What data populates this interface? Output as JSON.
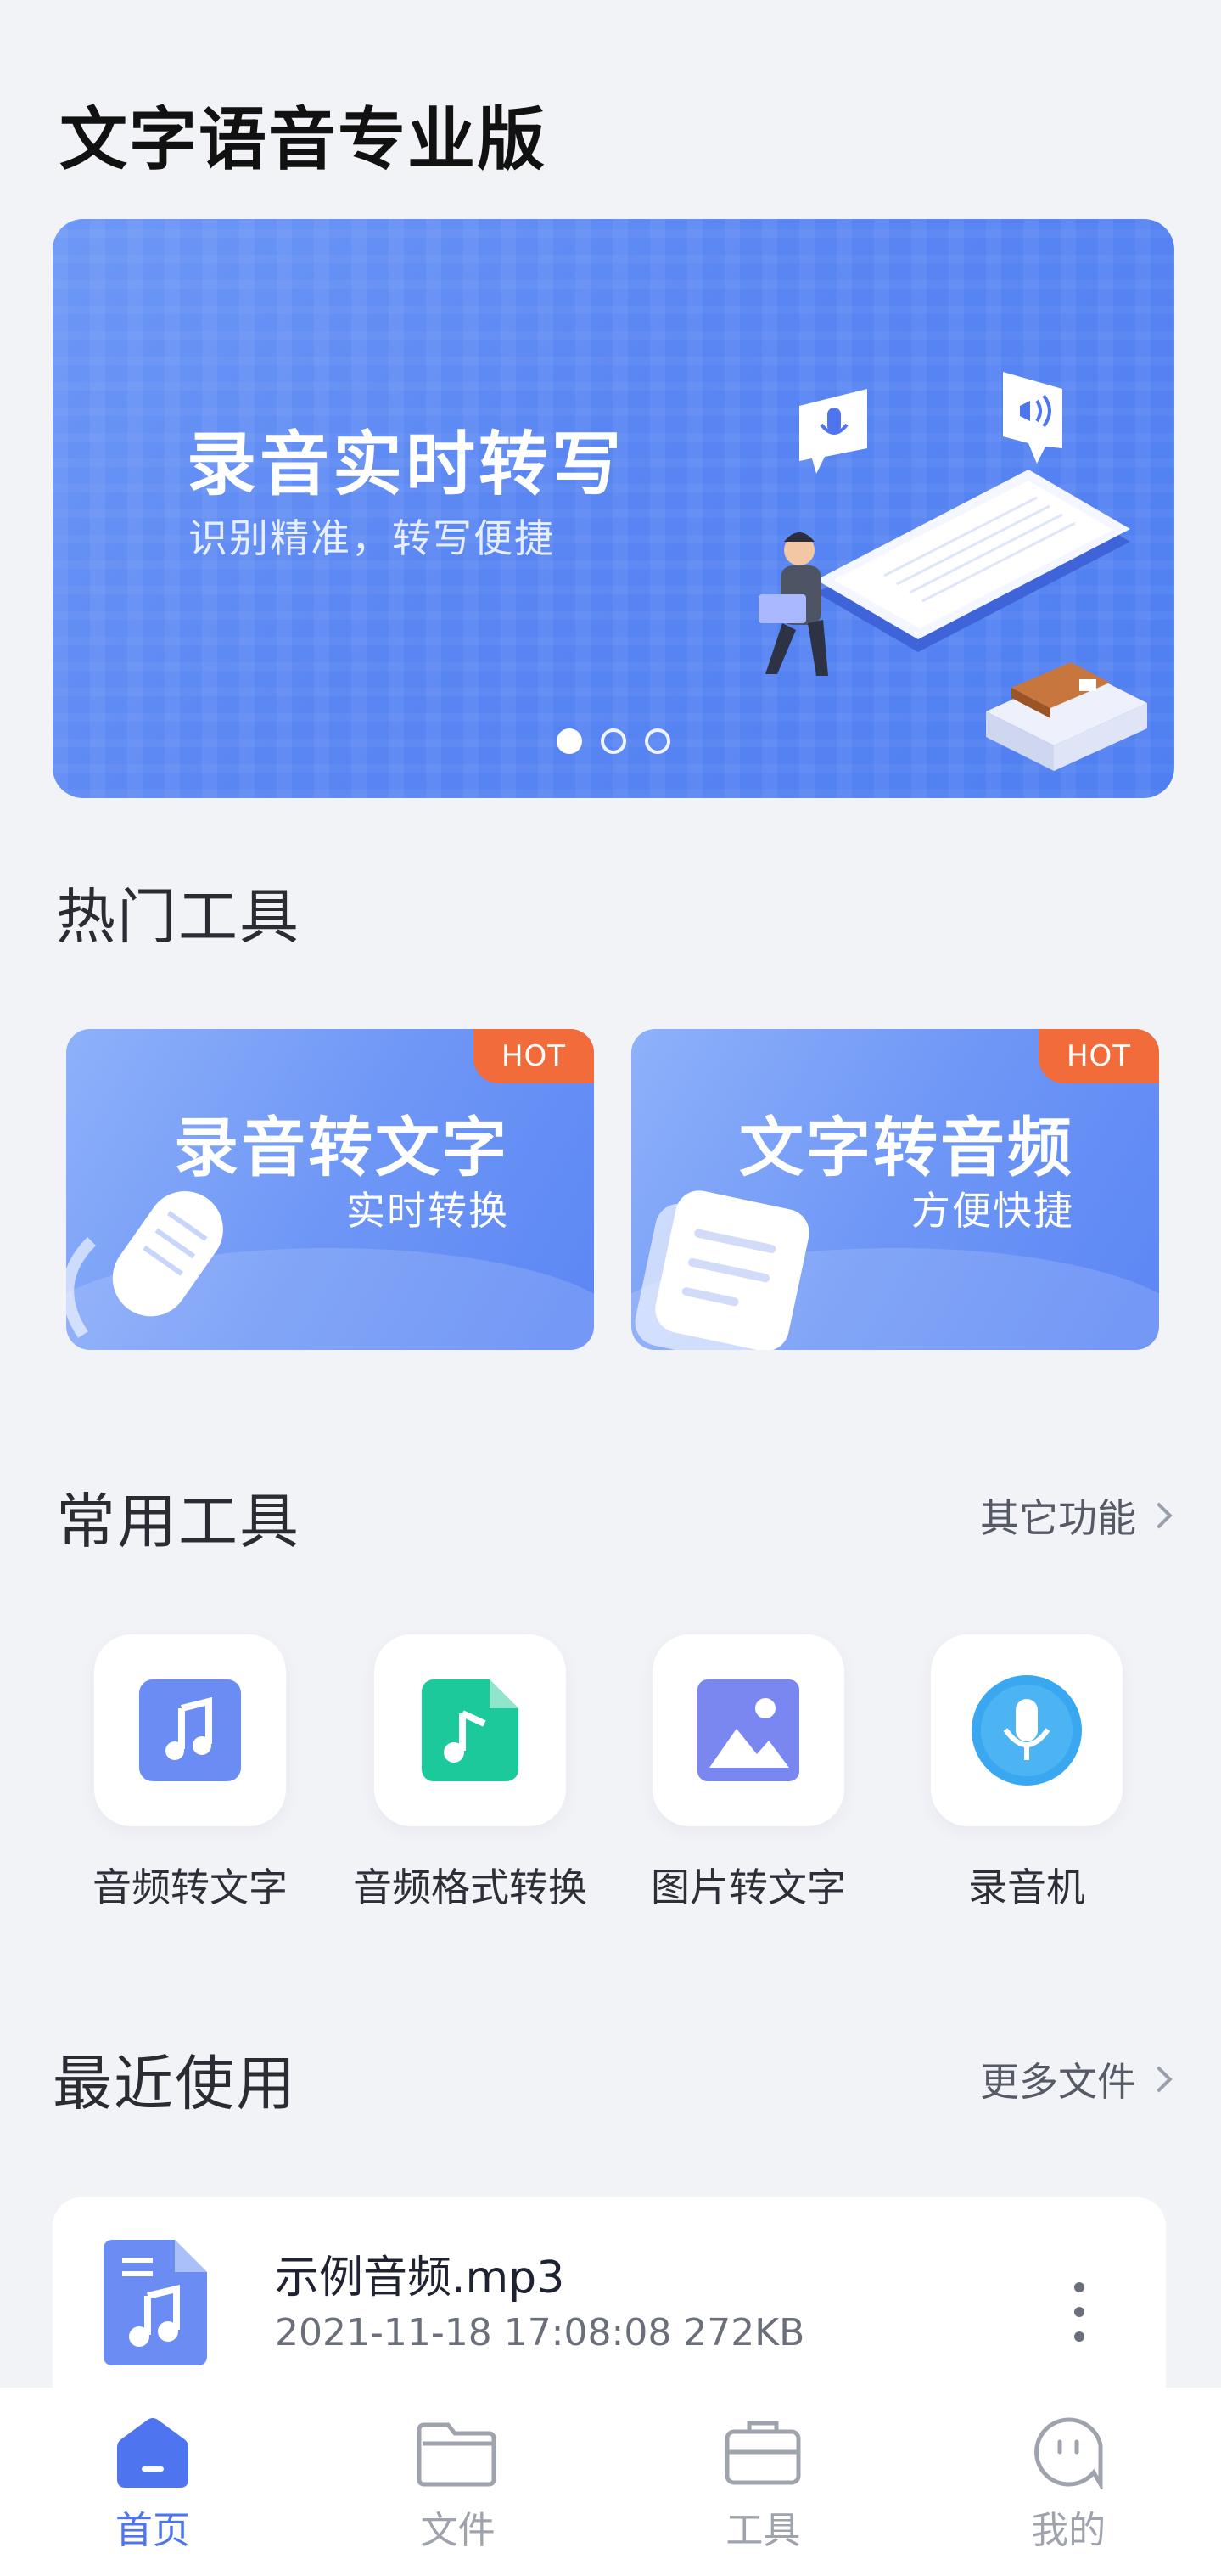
{
  "header": {
    "title": "文字语音专业版"
  },
  "banner": {
    "title": "录音实时转写",
    "subtitle": "识别精准，转写便捷",
    "slides": 3,
    "active_slide": 1
  },
  "hot_tools": {
    "title": "热门工具",
    "cards": [
      {
        "title": "录音转文字",
        "subtitle": "实时转换",
        "badge": "HOT",
        "icon": "microphone-icon"
      },
      {
        "title": "文字转音频",
        "subtitle": "方便快捷",
        "badge": "HOT",
        "icon": "document-icon"
      }
    ]
  },
  "common_tools": {
    "title": "常用工具",
    "more_label": "其它功能",
    "items": [
      {
        "label": "音频转文字",
        "icon": "music-note-icon",
        "color": "#6b8df3"
      },
      {
        "label": "音频格式转换",
        "icon": "music-file-icon",
        "color": "#1bc99a"
      },
      {
        "label": "图片转文字",
        "icon": "image-icon",
        "color": "#7a87f0"
      },
      {
        "label": "录音机",
        "icon": "microphone-icon",
        "color": "#3aa8f0"
      }
    ]
  },
  "recent": {
    "title": "最近使用",
    "more_label": "更多文件",
    "files": [
      {
        "name": "示例音频.mp3",
        "meta": "2021-11-18 17:08:08 272KB"
      }
    ]
  },
  "tabbar": {
    "tabs": [
      {
        "label": "首页",
        "icon": "home-icon",
        "active": true
      },
      {
        "label": "文件",
        "icon": "folder-icon",
        "active": false
      },
      {
        "label": "工具",
        "icon": "toolbox-icon",
        "active": false
      },
      {
        "label": "我的",
        "icon": "profile-icon",
        "active": false
      }
    ]
  },
  "colors": {
    "accent": "#4f74f0",
    "hot_badge": "#f26b3a",
    "background": "#f2f3f7"
  }
}
